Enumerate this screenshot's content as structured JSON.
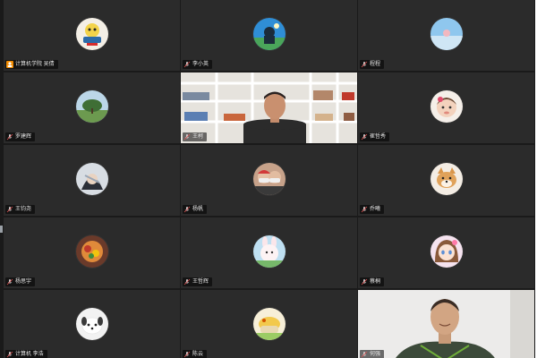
{
  "participants": [
    {
      "name": "计算机学院 吴倩",
      "type": "avatar",
      "avatar": "cartoon-yellow",
      "host": true
    },
    {
      "name": "李小英",
      "type": "avatar",
      "avatar": "blue-scene"
    },
    {
      "name": "程程",
      "type": "avatar",
      "avatar": "sky-light"
    },
    {
      "name": "罗建辉",
      "type": "avatar",
      "avatar": "tree-landscape"
    },
    {
      "name": "王柯",
      "type": "video",
      "avatar": "video-bookshelf"
    },
    {
      "name": "崔哲秀",
      "type": "avatar",
      "avatar": "baby-face"
    },
    {
      "name": "王钧尧",
      "type": "avatar",
      "avatar": "anime-dark"
    },
    {
      "name": "杨帆",
      "type": "avatar",
      "avatar": "masked-people"
    },
    {
      "name": "乔曦",
      "type": "avatar",
      "avatar": "shiba-dog"
    },
    {
      "name": "杨思宇",
      "type": "avatar",
      "avatar": "food-plate"
    },
    {
      "name": "王哲辉",
      "type": "avatar",
      "avatar": "cartoon-bunny"
    },
    {
      "name": "蔡桐",
      "type": "avatar",
      "avatar": "anime-girl"
    },
    {
      "name": "计算机 李浩",
      "type": "avatar",
      "avatar": "white-puppy"
    },
    {
      "name": "陈云",
      "type": "avatar",
      "avatar": "cartoon-hand"
    },
    {
      "name": "何强",
      "type": "video",
      "avatar": "video-man-white-wall"
    }
  ],
  "colors": {
    "tile_bg": "#2b2b2b",
    "page_bg": "#1a1a1a",
    "host_badge": "#f28b00"
  }
}
